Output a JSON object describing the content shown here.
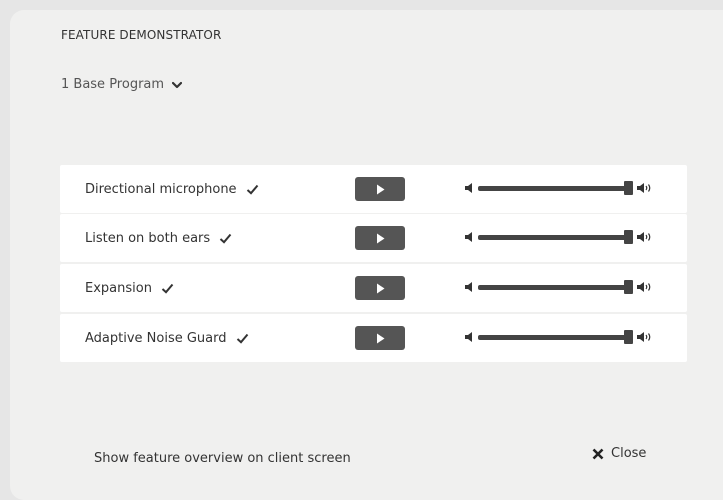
{
  "header": {
    "title": "FEATURE DEMONSTRATOR"
  },
  "program": {
    "selected": "1 Base Program"
  },
  "features": [
    {
      "label": "Directional microphone",
      "checked": true,
      "volume": 1.0
    },
    {
      "label": "Listen on both ears",
      "checked": true,
      "volume": 1.0
    },
    {
      "label": "Expansion",
      "checked": true,
      "volume": 1.0
    },
    {
      "label": "Adaptive Noise Guard",
      "checked": true,
      "volume": 1.0
    }
  ],
  "icons": {
    "check": "check-icon",
    "play": "play-icon",
    "volume_low": "volume-low-icon",
    "volume_high": "volume-high-icon",
    "chevron": "chevron-down-icon",
    "close": "close-icon"
  },
  "colors": {
    "button": "#555555",
    "panel": "#f0f0ef",
    "row": "#ffffff"
  },
  "footer": {
    "overview_label": "Show feature overview on client screen",
    "close_label": "Close"
  }
}
